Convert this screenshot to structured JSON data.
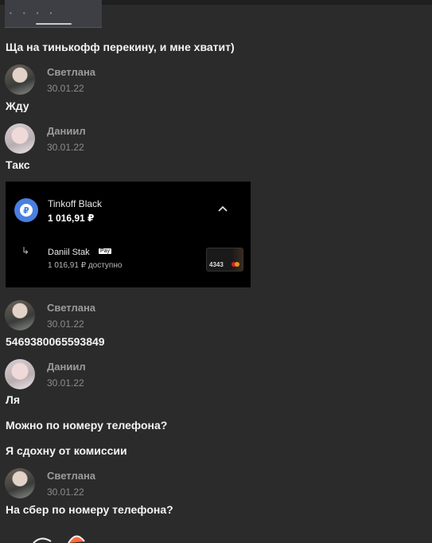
{
  "messages": {
    "m1": "Ща на тинькофф перекину, и мне хватит)",
    "m2": "Жду",
    "m3": "Такс",
    "m4": "5469380065593849",
    "m5": "Ля",
    "m6": "Можно по номеру телефона?",
    "m7": "Я сдохну от комиссии",
    "m8": "На сбер по номеру телефона?"
  },
  "senders": {
    "s1": {
      "name": "Светлана",
      "date": "30.01.22"
    },
    "s2": {
      "name": "Даниил",
      "date": "30.01.22"
    },
    "s3": {
      "name": "Светлана",
      "date": "30.01.22"
    },
    "s4": {
      "name": "Даниил",
      "date": "30.01.22"
    },
    "s5": {
      "name": "Светлана",
      "date": "30.01.22"
    }
  },
  "card": {
    "account_name": "Tinkoff Black",
    "balance": "1 016,91 ₽",
    "holder": "Daniil Stak",
    "pay_badge": "Pay",
    "available": "1 016,91 ₽ доступно",
    "card_digits": "4343",
    "bank_glyph": "₽",
    "colors": {
      "coin": "#4a7fe0",
      "bg": "#000000"
    }
  },
  "icons": {
    "chevron": "chevron-up-icon",
    "arrow": "return-arrow-icon"
  }
}
